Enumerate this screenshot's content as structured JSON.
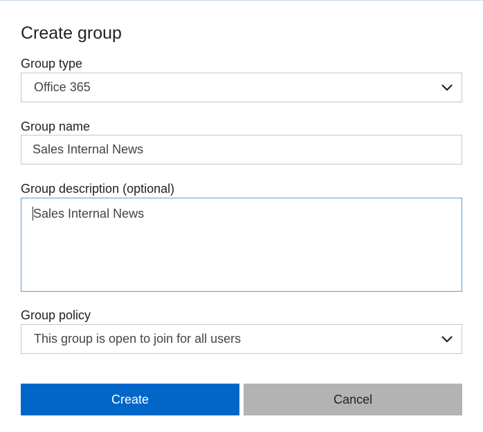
{
  "dialog": {
    "title": "Create group",
    "group_type": {
      "label": "Group type",
      "value": "Office 365",
      "icon": "chevron-down-icon"
    },
    "group_name": {
      "label": "Group name",
      "value": "Sales Internal News"
    },
    "group_description": {
      "label": "Group description (optional)",
      "value": "Sales Internal News"
    },
    "group_policy": {
      "label": "Group policy",
      "value": "This group is open to join for all users",
      "icon": "chevron-down-icon"
    },
    "buttons": {
      "create_label": "Create",
      "cancel_label": "Cancel"
    },
    "colors": {
      "primary": "#0067c9",
      "secondary": "#b3b3b3",
      "focus_border": "#5b9bd5",
      "field_border": "#c6c6c6"
    }
  }
}
